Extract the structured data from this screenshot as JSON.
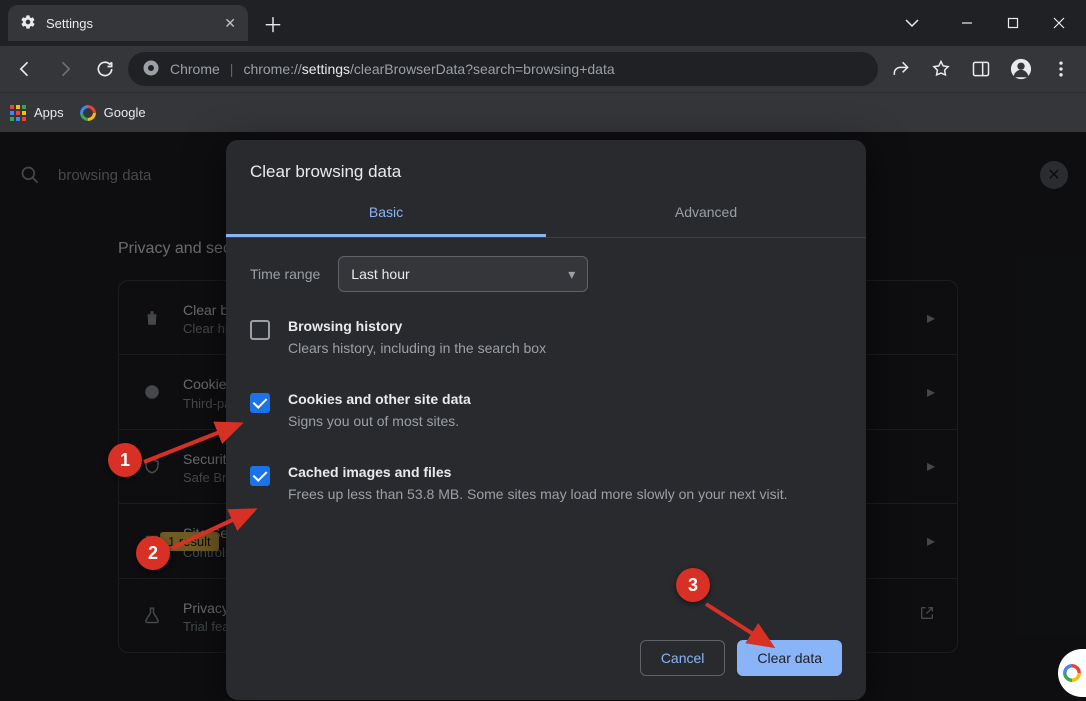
{
  "window": {
    "tab_title": "Settings"
  },
  "toolbar": {
    "chip": "Chrome",
    "url_prefix": "chrome://",
    "url_bold": "settings",
    "url_rest": "/clearBrowserData?search=browsing+data"
  },
  "bookmarks": {
    "apps": "Apps",
    "google": "Google"
  },
  "search": {
    "query": "browsing data"
  },
  "section": {
    "title": "Privacy and security"
  },
  "cards": [
    {
      "title": "Clear browsing data",
      "sub": "Clear history, cookies, cache, and more"
    },
    {
      "title": "Cookies and other site data",
      "sub": "Third-party cookies are blocked in Incognito mode"
    },
    {
      "title": "Security",
      "sub": "Safe Browsing (protection from dangerous sites) and other security settings"
    },
    {
      "title": "Site Settings",
      "sub": "Controls what information sites can use and show"
    },
    {
      "title": "Privacy Sandbox",
      "sub": "Trial features are on"
    }
  ],
  "result_tag": "1 result",
  "modal": {
    "title": "Clear browsing data",
    "tabs": {
      "basic": "Basic",
      "advanced": "Advanced"
    },
    "time_label": "Time range",
    "time_value": "Last hour",
    "options": [
      {
        "title": "Browsing history",
        "desc": "Clears history, including in the search box",
        "checked": false
      },
      {
        "title": "Cookies and other site data",
        "desc": "Signs you out of most sites.",
        "checked": true
      },
      {
        "title": "Cached images and files",
        "desc": "Frees up less than 53.8 MB. Some sites may load more slowly on your next visit.",
        "checked": true
      }
    ],
    "cancel": "Cancel",
    "clear": "Clear data"
  },
  "annotations": {
    "b1": "1",
    "b2": "2",
    "b3": "3"
  }
}
